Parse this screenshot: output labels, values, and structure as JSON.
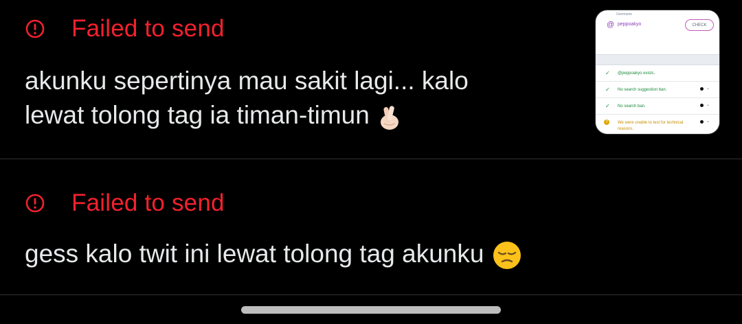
{
  "posts": [
    {
      "status": "Failed to send",
      "text_line1": "akunku sepertinya mau sakit lagi... kalo",
      "text_line2": "lewat tolong tag ia timan-timun",
      "emoji": "crossed-fingers-emoji",
      "attachment": {
        "caption": "Username",
        "at_symbol": "@",
        "handle": "peppoakyo",
        "check_label": "CHECK",
        "results": [
          {
            "mark": "✓",
            "text": "@peppoakyo exists.",
            "type": "ok"
          },
          {
            "mark": "✓",
            "text": "No search suggestion ban.",
            "type": "ok"
          },
          {
            "mark": "✓",
            "text": "No search ban.",
            "type": "ok"
          },
          {
            "mark": "?",
            "text": "We were unable to test for technical reasons.",
            "type": "warn"
          }
        ]
      }
    },
    {
      "status": "Failed to send",
      "text_line1": "gess kalo twit ini lewat tolong tag akunku",
      "emoji": "pensive-face-emoji"
    }
  ],
  "colors": {
    "background": "#000000",
    "error": "#f4212e",
    "text": "#e7e9ea",
    "divider": "#2f3336"
  }
}
